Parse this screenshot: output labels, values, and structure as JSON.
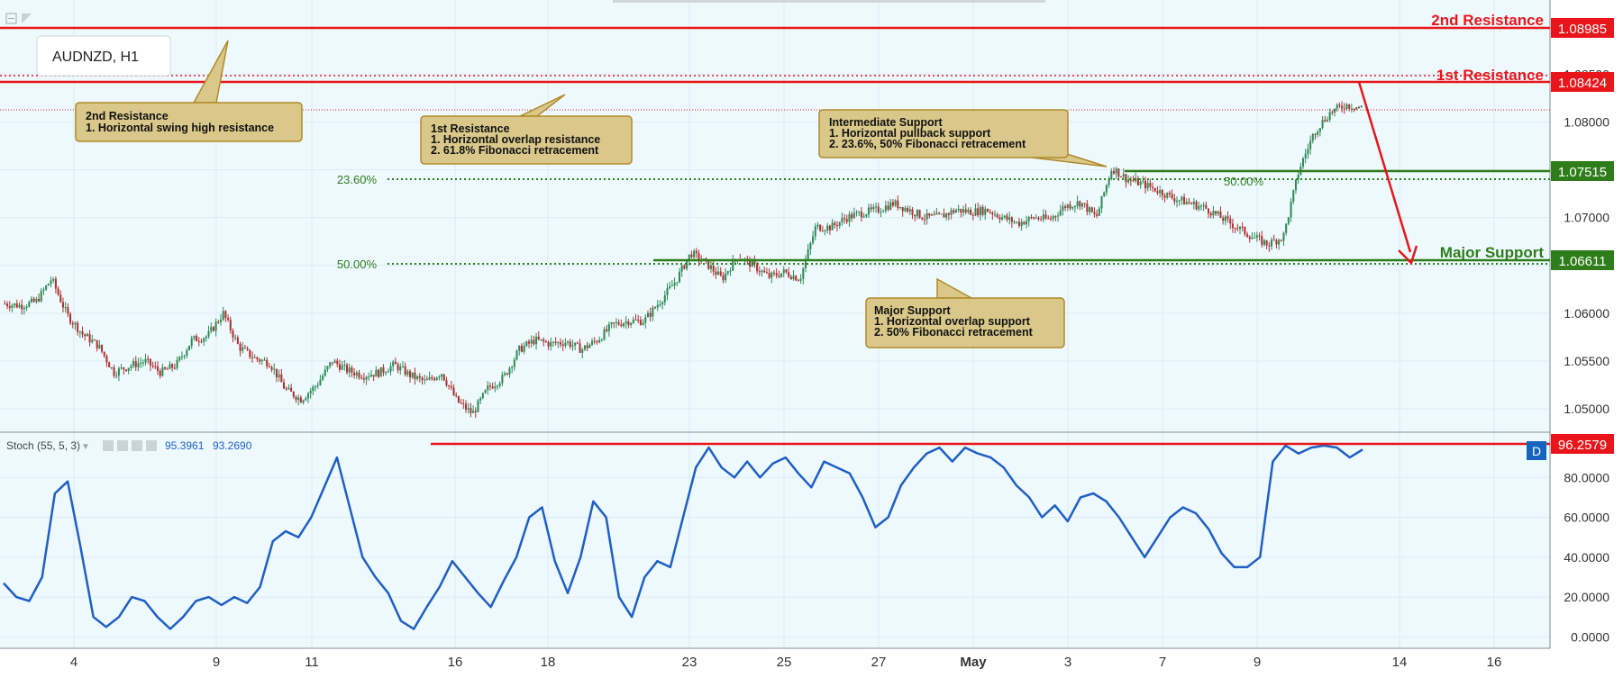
{
  "symbol": "AUDNZD, H1",
  "colors": {
    "bg": "#eef9fd",
    "grid": "#dcecf3",
    "red": "#e8161b",
    "green": "#2e7d1a",
    "blue": "#1f5fc6",
    "note_fill": "#d9c88a",
    "note_stroke": "#b08a28",
    "candle_up": "#2e8b57",
    "candle_down": "#b03030"
  },
  "levels": {
    "r2": {
      "label": "2nd Resistance",
      "value": "1.08985"
    },
    "r1": {
      "label": "1st Resistance",
      "value": "1.08424"
    },
    "intermediate": {
      "value": "1.07515"
    },
    "major": {
      "label": "Major Support",
      "value": "1.06611"
    }
  },
  "fib_labels": {
    "f236": "23.60%",
    "f50": "50.00%",
    "f50b": "50.00%"
  },
  "notes": [
    {
      "id": "r2",
      "lines": [
        "2nd Resistance",
        "1. Horizontal swing high resistance"
      ]
    },
    {
      "id": "r1",
      "lines": [
        "1st Resistance",
        "1. Horizontal overlap resistance",
        "2. 61.8% Fibonacci retracement"
      ]
    },
    {
      "id": "intermediate",
      "lines": [
        "Intermediate Support",
        "1. Horizontal pullback support",
        "2. 23.6%, 50% Fibonacci retracement"
      ]
    },
    {
      "id": "major",
      "lines": [
        "Major Support",
        "1. Horizontal overlap support",
        "2. 50% Fibonacci retracement"
      ]
    }
  ],
  "stoch": {
    "label": "Stoch (55, 5, 3)",
    "value1": "95.3961",
    "value2": "93.2690",
    "level": "96.2579",
    "badge": "D"
  },
  "chart_data": [
    {
      "type": "line",
      "title": "AUDNZD, H1",
      "series": [
        {
          "values": [
            1.061,
            1.0608,
            1.0612,
            1.0636,
            1.0598,
            1.0578,
            1.0566,
            1.0538,
            1.0545,
            1.055,
            1.0538,
            1.0546,
            1.0572,
            1.0576,
            1.06,
            1.0565,
            1.0553,
            1.0548,
            1.052,
            1.051,
            1.0525,
            1.055,
            1.054,
            1.0535,
            1.0538,
            1.0546,
            1.0535,
            1.0528,
            1.0538,
            1.0508,
            1.0495,
            1.0522,
            1.0533,
            1.0562,
            1.0572,
            1.0568,
            1.057,
            1.0562,
            1.0572,
            1.0588,
            1.0592,
            1.0592,
            1.0612,
            1.0633,
            1.0663,
            1.0652,
            1.0636,
            1.066,
            1.065,
            1.0638,
            1.0643,
            1.0636,
            1.069,
            1.069,
            1.07,
            1.0705,
            1.0708,
            1.0715,
            1.0708,
            1.07,
            1.0701,
            1.0708,
            1.0706,
            1.0708,
            1.07,
            1.0694,
            1.07,
            1.0698,
            1.0712,
            1.0716,
            1.07,
            1.0752,
            1.074,
            1.0735,
            1.0728,
            1.072,
            1.0715,
            1.071,
            1.07,
            1.069,
            1.068,
            1.0672,
            1.068,
            1.075,
            1.079,
            1.081,
            1.0818,
            1.0815
          ]
        }
      ],
      "y_ticks": [
        "1.05000",
        "1.05500",
        "1.06000",
        "1.06500",
        "1.07000",
        "1.07500",
        "1.08000",
        "1.08500"
      ],
      "ylim": [
        1.0485,
        1.092
      ],
      "x_ticks": [
        "4",
        "9",
        "11",
        "16",
        "18",
        "23",
        "25",
        "27",
        "May",
        "3",
        "7",
        "9",
        "14",
        "16"
      ]
    },
    {
      "type": "line",
      "title": "Stoch (55, 5, 3)",
      "series": [
        {
          "values": [
            27,
            20,
            18,
            30,
            72,
            78,
            45,
            10,
            5,
            10,
            20,
            18,
            10,
            4,
            10,
            18,
            20,
            16,
            20,
            17,
            25,
            48,
            53,
            50,
            60,
            75,
            90,
            65,
            40,
            30,
            22,
            8,
            4,
            15,
            25,
            38,
            30,
            22,
            15,
            28,
            40,
            60,
            65,
            38,
            22,
            40,
            68,
            60,
            20,
            10,
            30,
            38,
            35,
            60,
            85,
            95,
            85,
            80,
            88,
            80,
            87,
            90,
            82,
            75,
            88,
            85,
            82,
            70,
            55,
            60,
            76,
            85,
            92,
            95,
            88,
            95,
            92,
            90,
            85,
            76,
            70,
            60,
            66,
            58,
            70,
            72,
            68,
            60,
            50,
            40,
            50,
            60,
            65,
            62,
            54,
            42,
            35,
            35,
            40,
            88,
            96,
            92,
            95,
            96,
            95,
            90,
            94
          ]
        }
      ],
      "y_ticks": [
        "0.0000",
        "20.0000",
        "40.0000",
        "60.0000",
        "80.0000"
      ],
      "ylim": [
        -3,
        100
      ]
    }
  ]
}
